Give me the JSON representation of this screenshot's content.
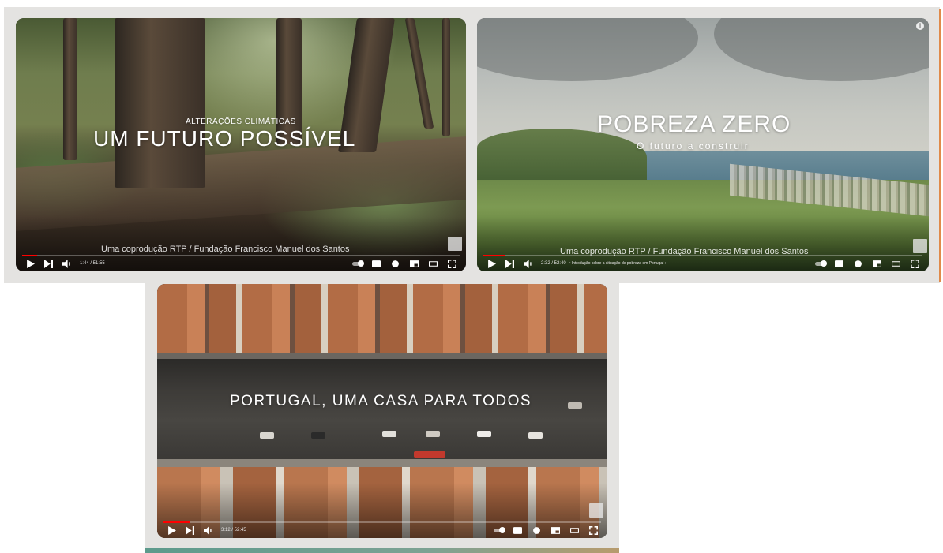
{
  "videos": [
    {
      "supertitle": "ALTERAÇÕES CLIMÁTICAS",
      "title": "UM FUTURO POSSÍVEL",
      "subtitle": "",
      "credit": "Uma coprodução RTP / Fundação Francisco Manuel dos Santos",
      "time": "1:44 / 51:55",
      "chapter": "",
      "progress": 0.034
    },
    {
      "supertitle": "",
      "title": "POBREZA ZERO",
      "subtitle": "O futuro a construir",
      "credit": "Uma coprodução RTP / Fundação Francisco Manuel dos Santos",
      "time": "2:32 / 52:40",
      "chapter": "• Introdução sobre a situação de pobreza em Portugal ›",
      "progress": 0.048
    },
    {
      "supertitle": "",
      "title": "PORTUGAL, UMA CASA PARA TODOS",
      "subtitle": "",
      "credit": "",
      "time": "3:12 / 52:45",
      "chapter": "",
      "progress": 0.061
    }
  ],
  "icons": {
    "play": "play-icon",
    "next": "next-icon",
    "volume": "volume-icon",
    "autoplay": "autoplay-toggle",
    "subtitles": "subtitles-icon",
    "settings": "gear-icon",
    "miniplayer": "miniplayer-icon",
    "theater": "theater-icon",
    "fullscreen": "fullscreen-icon",
    "info": "info-icon"
  },
  "colors": {
    "progress": "#ff0000",
    "panel": "#e4e3e1",
    "accent_edge": "#e08a4a"
  }
}
